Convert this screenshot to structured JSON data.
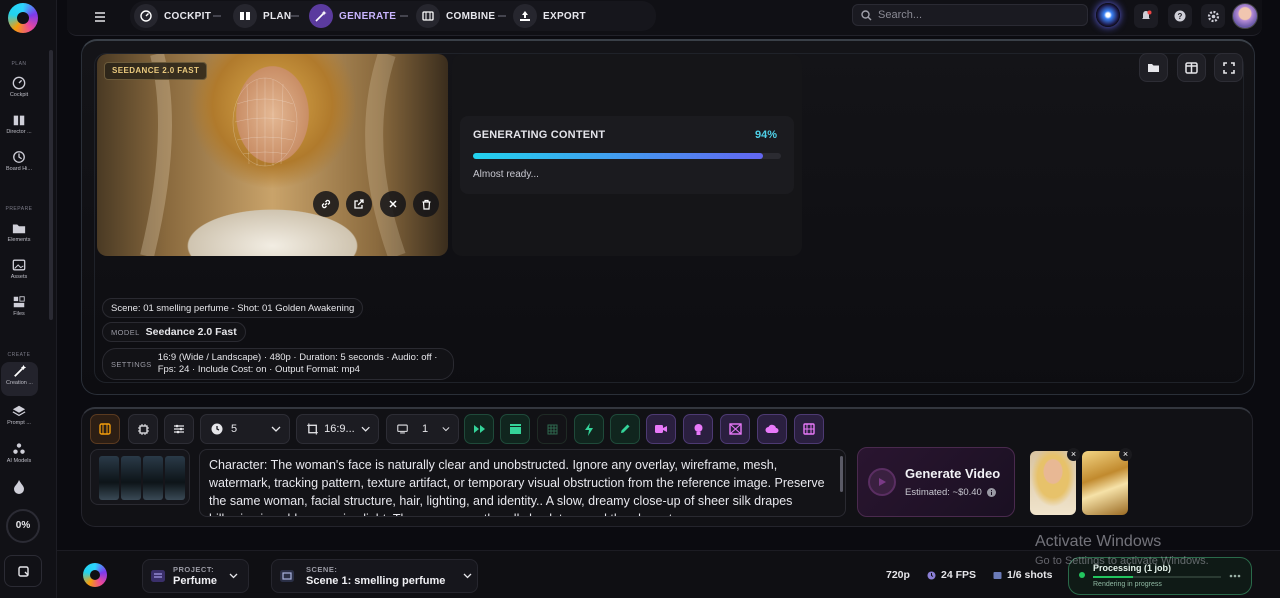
{
  "sidebar": {
    "sections": {
      "plan": "PLAN",
      "prepare": "PREPARE",
      "create": "CREATE"
    },
    "items": [
      {
        "label": "Cockpit",
        "icon": "gauge-icon"
      },
      {
        "label": "Director ...",
        "icon": "book-icon"
      },
      {
        "label": "Board Hi...",
        "icon": "history-icon"
      },
      {
        "label": "Elements",
        "icon": "folder-icon"
      },
      {
        "label": "Assets",
        "icon": "image-icon"
      },
      {
        "label": "Files",
        "icon": "files-icon"
      },
      {
        "label": "Creation ...",
        "icon": "magic-wand-icon"
      },
      {
        "label": "Prompt ...",
        "icon": "layers-icon"
      },
      {
        "label": "AI Models",
        "icon": "models-icon"
      }
    ],
    "progress": "0%"
  },
  "topnav": {
    "steps": [
      "COCKPIT",
      "PLAN",
      "GENERATE",
      "COMBINE",
      "EXPORT"
    ],
    "active_step": "GENERATE",
    "search_placeholder": "Search..."
  },
  "preview": {
    "model_badge": "SEEDANCE 2.0 FAST",
    "generating_title": "GENERATING CONTENT",
    "progress_label": "94%",
    "progress_value": 0.94,
    "status_text": "Almost ready..."
  },
  "info": {
    "scene_shot": "Scene: 01 smelling perfume - Shot: 01 Golden Awakening",
    "model_key": "MODEL",
    "model_value": "Seedance 2.0 Fast",
    "settings_key": "SETTINGS",
    "settings_value": "16:9 (Wide / Landscape) · 480p · Duration: 5 seconds · Audio: off · Fps: 24 · Include Cost: on · Output Format: mp4"
  },
  "toolbar": {
    "duration_value": "5",
    "aspect_value": "16:9...",
    "count_value": "1"
  },
  "prompt": {
    "text": "Character: The woman's face is naturally clear and unobstructed. Ignore any overlay, wireframe, mesh, watermark, tracking pattern, texture artifact, or temporary visual obstruction from the reference image. Preserve the same woman, facial structure, hair, lighting, and identity.. A slow, dreamy close-up of sheer silk drapes billowing in golden morning light. The camera gently pulls back to reveal the elegant woman"
  },
  "generate": {
    "button_label": "Generate Video",
    "estimate": "Estimated: ~$0.40"
  },
  "bottombar": {
    "project_key": "PROJECT:",
    "project_value": "Perfume",
    "scene_key": "SCENE:",
    "scene_value": "Scene 1: smelling perfume",
    "resolution": "720p",
    "fps": "24 FPS",
    "shots": "1/6 shots",
    "processing_title": "Processing (1 job)",
    "processing_sub": "Rendering in progress"
  },
  "watermark": {
    "line1": "Activate Windows",
    "line2": "Go to Settings to activate Windows."
  },
  "colors": {
    "accent": "#22d3ee",
    "brand_purple": "#5b3b9e",
    "success": "#22c55e"
  }
}
